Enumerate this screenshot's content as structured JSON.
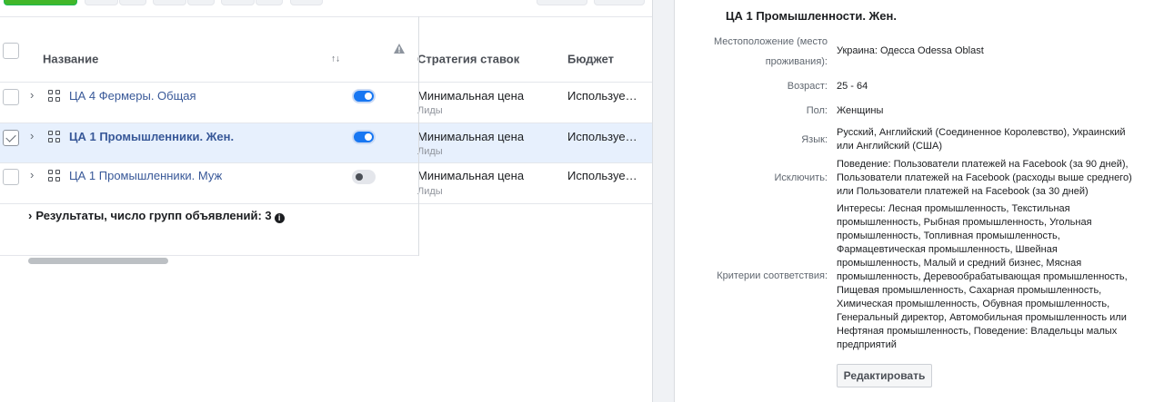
{
  "table": {
    "columns": {
      "name": "Название",
      "sort_icon": "↑↓",
      "strategy": "Стратегия ставок",
      "budget": "Бюджет"
    },
    "rows": [
      {
        "name": "ЦА 4 Фермеры. Общая",
        "selected": false,
        "toggle_on": true,
        "strategy": "Минимальная цена",
        "strategy_sub": "Лиды",
        "budget": "Используе…"
      },
      {
        "name": "ЦА 1 Промышленники. Жен.",
        "selected": true,
        "toggle_on": true,
        "strategy": "Минимальная цена",
        "strategy_sub": "Лиды",
        "budget": "Используе…"
      },
      {
        "name": "ЦА 1 Промышленники. Муж",
        "selected": false,
        "toggle_on": false,
        "strategy": "Минимальная цена",
        "strategy_sub": "Лиды",
        "budget": "Используе…"
      }
    ],
    "summary": "Результаты, число групп объявлений: 3"
  },
  "detail": {
    "title": "ЦА 1 Промышленности. Жен.",
    "location_label": "Местоположение (место проживания):",
    "location_label_1": "Местоположение (место",
    "location_label_2": "проживания):",
    "location_value": "Украина: Одесса Odessa Oblast",
    "age_label": "Возраст:",
    "age_value": "25 - 64",
    "gender_label": "Пол:",
    "gender_value": "Женщины",
    "language_label": "Язык:",
    "language_value": "Русский, Английский (Соединенное Королевство), Украинский или Английский (США)",
    "exclude_label": "Исключить:",
    "exclude_value": "Поведение: Пользователи платежей на Facebook (за 90 дней), Пользователи платежей на Facebook (расходы выше среднего) или Пользователи платежей на Facebook (за 30 дней)",
    "criteria_label": "Критерии соответствия:",
    "criteria_value": "Интересы: Лесная промышленность, Текстильная промышленность, Рыбная промышленность, Угольная промышленность, Топливная промышленность, Фармацевтическая промышленность, Швейная промышленность, Малый и средний бизнес, Мясная промышленность, Деревообрабатывающая промышленность, Пищевая промышленность, Сахарная промышленность, Химическая промышленность, Обувная промышленность, Генеральный директор, Автомобильная промышленность или Нефтяная промышленность, Поведение: Владельцы малых предприятий",
    "edit_label": "Редактировать"
  }
}
